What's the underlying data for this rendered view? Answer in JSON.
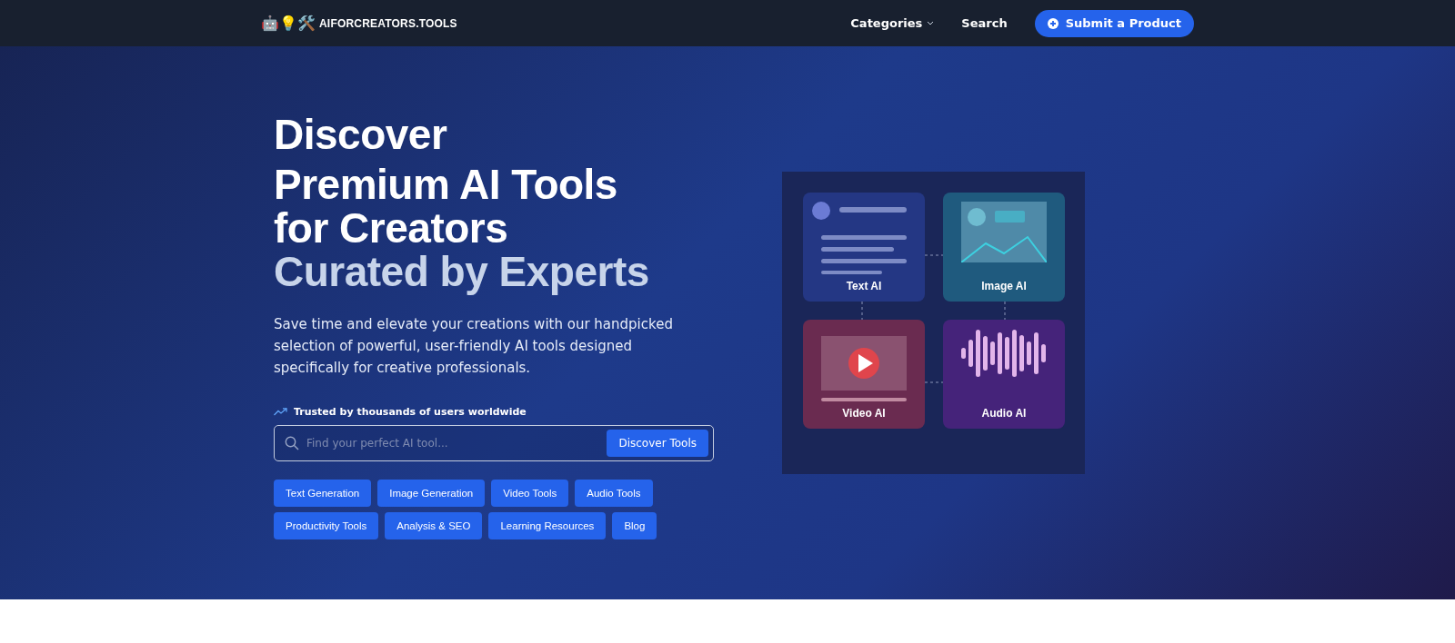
{
  "nav": {
    "logo_emoji": "🤖💡🛠️",
    "logo_text": "AIFORCREATORS.TOOLS",
    "links": [
      {
        "label": "Categories",
        "dropdown": true
      },
      {
        "label": "Search",
        "dropdown": false
      }
    ],
    "cta": "Submit a Product"
  },
  "hero": {
    "heading_lines": [
      {
        "text": "Discover",
        "kind": "plain"
      },
      {
        "text": "Premium AI Tools",
        "kind": "plain"
      },
      {
        "text": "for Creators",
        "kind": "plain"
      },
      {
        "text": "Curated by Experts",
        "kind": "muted"
      }
    ],
    "subtitle": "Save time and elevate your creations with our handpicked selection of powerful, user-friendly AI tools designed specifically for creative professionals.",
    "trust": "Trusted by thousands of users worldwide",
    "search": {
      "placeholder": "Find your perfect AI tool...",
      "button": "Discover Tools"
    },
    "tags": [
      {
        "label": "Text Generation"
      },
      {
        "label": "Image Generation"
      },
      {
        "label": "Video Tools"
      },
      {
        "label": "Audio Tools"
      },
      {
        "label": "Productivity Tools"
      },
      {
        "label": "Analysis & SEO"
      },
      {
        "label": "Learning Resources"
      },
      {
        "label": "Blog"
      }
    ]
  },
  "illustration": {
    "cards": [
      {
        "kind": "text",
        "label": "Text AI"
      },
      {
        "kind": "image",
        "label": "Image AI"
      },
      {
        "kind": "video",
        "label": "Video AI"
      },
      {
        "kind": "audio",
        "label": "Audio AI"
      }
    ]
  }
}
